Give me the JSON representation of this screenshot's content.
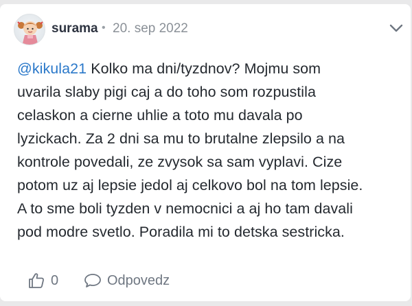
{
  "comment": {
    "author": "surama",
    "separator": "•",
    "date": "20. sep 2022",
    "mention": "@kikula21",
    "text": " Kolko ma dni/tyzdnov? Mojmu som\nuvarila slaby pigi caj a do toho som rozpustila\ncelaskon a cierne uhlie a toto mu davala po\nlyzickach. Za 2 dni sa mu to brutalne zlepsilo a na\nkontrole povedali, ze zvysok sa sam vyplavi. Cize\npotom uz aj lepsie jedol aj celkovo bol na tom lepsie.\nA to sme boli tyzden v nemocnici a aj ho tam davali\npod modre svetlo. Poradila mi to detska sestricka.",
    "like_count": "0",
    "reply_label": "Odpovedz"
  },
  "icons": {
    "avatar": "girl-avatar-icon",
    "menu": "chevron-down-icon",
    "like": "thumbs-up-icon",
    "reply": "speech-bubble-icon"
  },
  "colors": {
    "background": "#e9e9ea",
    "card": "#ffffff",
    "mention": "#2a78c9",
    "text": "#24292f",
    "muted": "#8a9097"
  }
}
